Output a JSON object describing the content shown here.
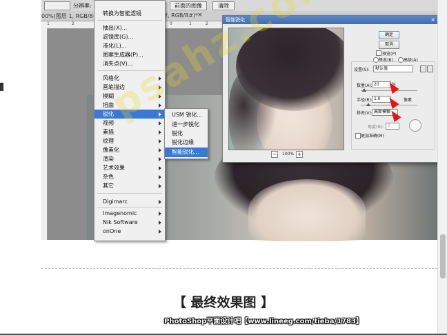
{
  "toolbar": {
    "label_left": "分辨率:",
    "convert_smart": "转换为智能滤镜",
    "btn_front": "前面的图像",
    "btn_clear": "清除"
  },
  "tabs": {
    "doc1": "00%(图层 1, RGB/8#)*",
    "doc2": "2, RGB/8#)*"
  },
  "ruler": [
    "1",
    "2",
    "0",
    "1",
    "2",
    "4",
    "6",
    "2",
    "2"
  ],
  "menu": {
    "items": [
      {
        "label": "转换为智能滤镜",
        "submenu": false
      },
      {
        "label": "抽出(X)...",
        "submenu": false
      },
      {
        "label": "滤镜库(G)...",
        "submenu": false
      },
      {
        "label": "液化(L)...",
        "submenu": false
      },
      {
        "label": "图案生成器(P)...",
        "submenu": false
      },
      {
        "label": "消失点(V)...",
        "submenu": false
      },
      {
        "label": "风格化",
        "submenu": true
      },
      {
        "label": "画笔描边",
        "submenu": true
      },
      {
        "label": "模糊",
        "submenu": true
      },
      {
        "label": "扭曲",
        "submenu": true
      },
      {
        "label": "锐化",
        "submenu": true,
        "highlighted": true
      },
      {
        "label": "视频",
        "submenu": true
      },
      {
        "label": "素描",
        "submenu": true
      },
      {
        "label": "纹理",
        "submenu": true
      },
      {
        "label": "像素化",
        "submenu": true
      },
      {
        "label": "渲染",
        "submenu": true
      },
      {
        "label": "艺术效果",
        "submenu": true
      },
      {
        "label": "杂色",
        "submenu": true
      },
      {
        "label": "其它",
        "submenu": true
      },
      {
        "label": "Digimarc",
        "submenu": true
      },
      {
        "label": "Imagenomic",
        "submenu": true
      },
      {
        "label": "Nik Software",
        "submenu": true
      },
      {
        "label": "onOne",
        "submenu": true
      }
    ]
  },
  "submenu": {
    "items": [
      {
        "label": "USM 锐化..."
      },
      {
        "label": "进一步锐化"
      },
      {
        "label": "锐化"
      },
      {
        "label": "锐化边缘"
      },
      {
        "label": "智能锐化...",
        "highlighted": true
      }
    ]
  },
  "dialog": {
    "title": "智能锐化",
    "ok": "确定",
    "cancel": "取消",
    "preview": "预览(P)",
    "basic": "基本(B)",
    "advanced": "高级(A)",
    "settings_label": "设置(S):",
    "settings_value": "默认值",
    "amount_label": "数量(A):",
    "amount_value": "20",
    "amount_unit": "%",
    "radius_label": "半径(R):",
    "radius_value": "1.0",
    "radius_unit": "像素",
    "remove_label": "移去(V):",
    "remove_value": "高斯模糊",
    "angle_label": "角度(N):",
    "angle_value": "0",
    "more_accurate": "更加准确(M)",
    "zoom": "100%",
    "zoom_minus": "−",
    "zoom_plus": "+"
  },
  "page": {
    "heading": "【 最终效果图 】",
    "watermark_bar": "PhotoShop平面设计吧【www.lineeg.com/tieba/1783】",
    "watermark_overlay": "psahz.com"
  },
  "colors": {
    "menu_highlight": "#3a78d6",
    "cursor": "#e11111",
    "watermark": "#e6dc28"
  }
}
